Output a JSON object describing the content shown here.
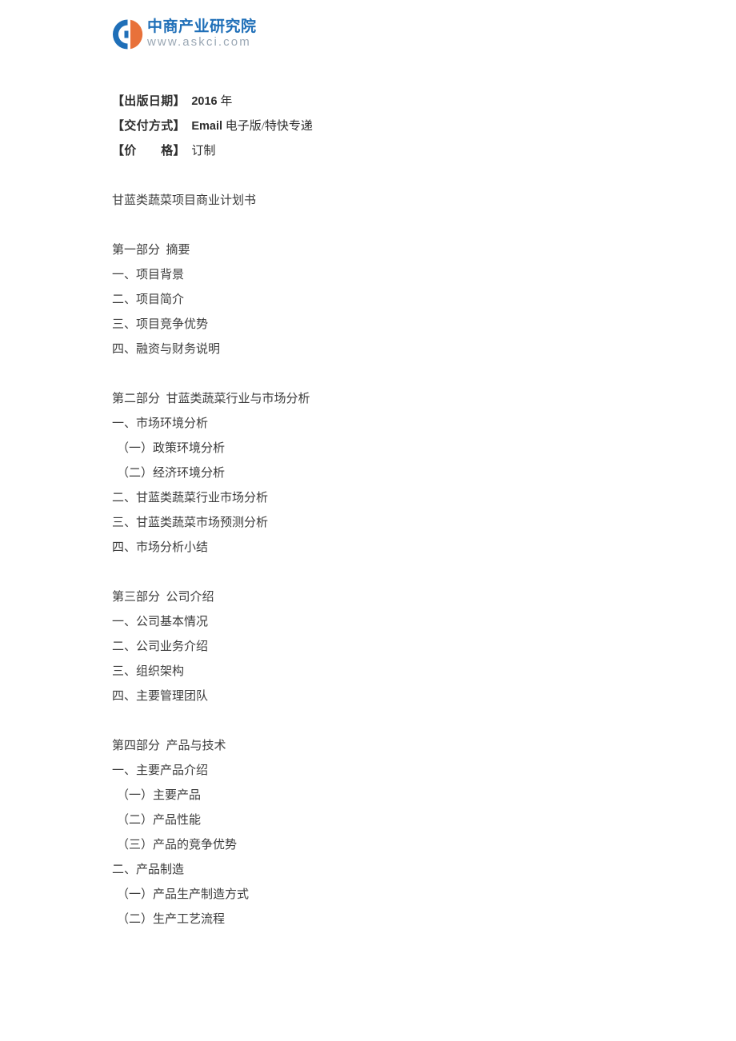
{
  "logo": {
    "mark_name": "askci-circular-logo",
    "company_cn": "中商产业研究院",
    "url": "www.askci.com",
    "colors": {
      "blue": "#1f6fb8",
      "orange": "#e8713a",
      "url_gray": "#9aa7b4"
    }
  },
  "meta": [
    {
      "label": "【出版日期】",
      "value_latin": "2016",
      "value_cn": " 年"
    },
    {
      "label": "【交付方式】",
      "value_latin": "Email",
      "value_cn": " 电子版/特快专递"
    },
    {
      "label": "【价　　格】",
      "value_latin": "",
      "value_cn": "订制"
    }
  ],
  "document_title": "甘蓝类蔬菜项目商业计划书",
  "sections": [
    {
      "heading": "第一部分  摘要",
      "items": [
        {
          "text": "一、项目背景",
          "level": 1
        },
        {
          "text": "二、项目简介",
          "level": 1
        },
        {
          "text": "三、项目竞争优势",
          "level": 1
        },
        {
          "text": "四、融资与财务说明",
          "level": 1
        }
      ]
    },
    {
      "heading": "第二部分  甘蓝类蔬菜行业与市场分析",
      "items": [
        {
          "text": "一、市场环境分析",
          "level": 1
        },
        {
          "text": "（一）政策环境分析",
          "level": 2
        },
        {
          "text": "（二）经济环境分析",
          "level": 2
        },
        {
          "text": "二、甘蓝类蔬菜行业市场分析",
          "level": 1
        },
        {
          "text": "三、甘蓝类蔬菜市场预测分析",
          "level": 1
        },
        {
          "text": "四、市场分析小结",
          "level": 1
        }
      ]
    },
    {
      "heading": "第三部分  公司介绍",
      "items": [
        {
          "text": "一、公司基本情况",
          "level": 1
        },
        {
          "text": "二、公司业务介绍",
          "level": 1
        },
        {
          "text": "三、组织架构",
          "level": 1
        },
        {
          "text": "四、主要管理团队",
          "level": 1
        }
      ]
    },
    {
      "heading": "第四部分  产品与技术",
      "items": [
        {
          "text": "一、主要产品介绍",
          "level": 1
        },
        {
          "text": "（一）主要产品",
          "level": 2
        },
        {
          "text": "（二）产品性能",
          "level": 2
        },
        {
          "text": "（三）产品的竞争优势",
          "level": 2
        },
        {
          "text": "二、产品制造",
          "level": 1
        },
        {
          "text": "（一）产品生产制造方式",
          "level": 2
        },
        {
          "text": "（二）生产工艺流程",
          "level": 2
        }
      ]
    }
  ]
}
